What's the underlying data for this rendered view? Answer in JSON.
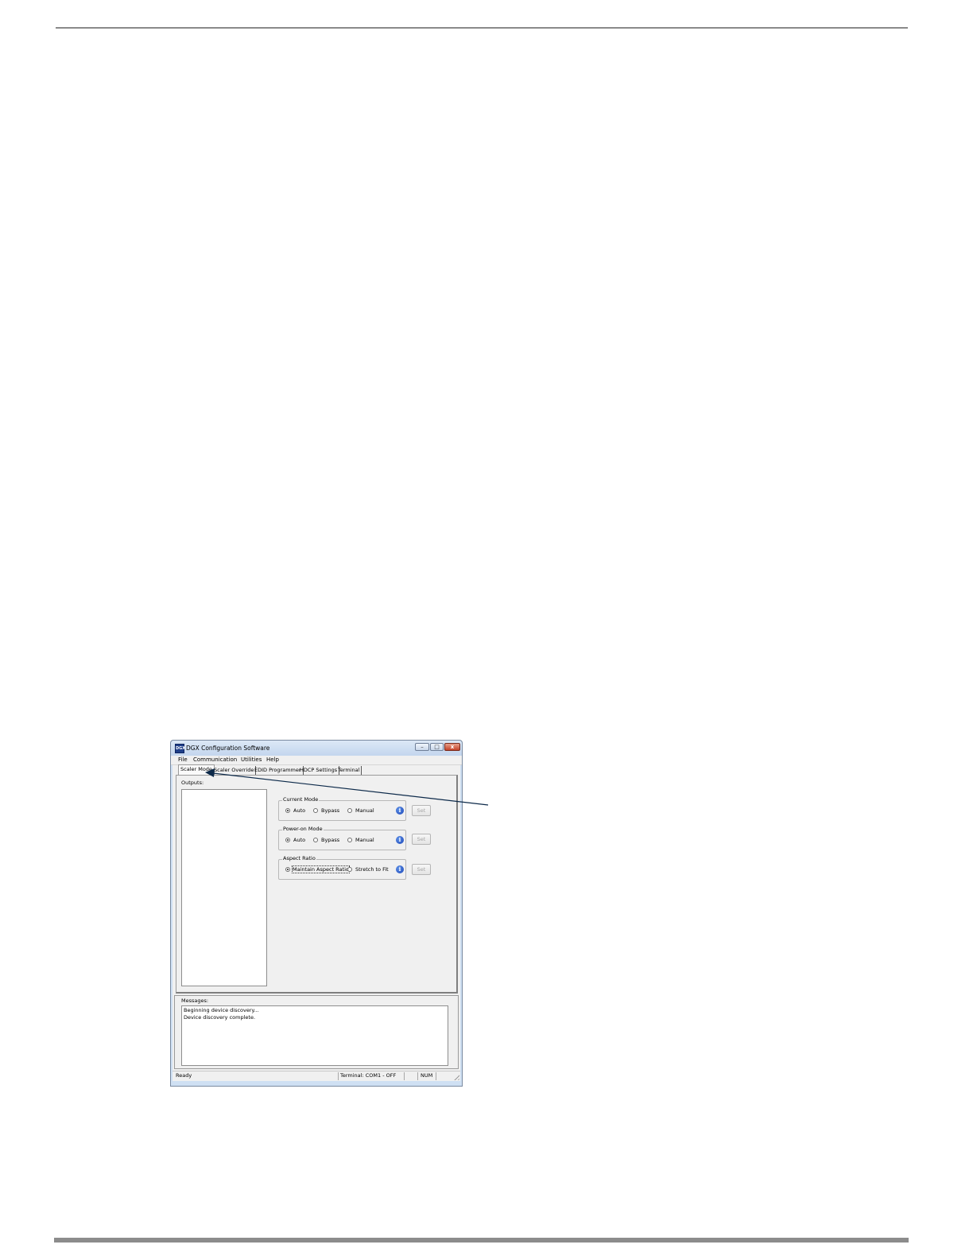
{
  "window": {
    "app_icon_text": "DGX",
    "title": "DGX Configuration Software",
    "minimize_glyph": "–",
    "maximize_glyph": "□",
    "close_glyph": "x"
  },
  "menu": {
    "items": [
      "File",
      "Communication",
      "Utilities",
      "Help"
    ]
  },
  "tabs": {
    "items": [
      "Scaler Mode",
      "Scaler Override",
      "EDID Programmer",
      "HDCP Settings",
      "Terminal"
    ],
    "active": "Scaler Mode"
  },
  "scaler_mode": {
    "outputs_label": "Outputs:",
    "current_mode": {
      "title": "Current Mode",
      "options": [
        "Auto",
        "Bypass",
        "Manual"
      ],
      "selected": "Auto",
      "set_label": "Set"
    },
    "power_on_mode": {
      "title": "Power-on Mode",
      "options": [
        "Auto",
        "Bypass",
        "Manual"
      ],
      "selected": "Auto",
      "set_label": "Set"
    },
    "aspect_ratio": {
      "title": "Aspect Ratio",
      "options": [
        "Maintain Aspect Ratio",
        "Stretch to Fit"
      ],
      "selected": "Maintain Aspect Ratio",
      "set_label": "Set"
    },
    "info_glyph": "i"
  },
  "messages": {
    "label": "Messages:",
    "lines": [
      "Beginning device discovery...",
      "Device discovery complete."
    ]
  },
  "statusbar": {
    "status": "Ready",
    "terminal": "Terminal: COM1 - OFF",
    "num": "NUM"
  },
  "colors": {
    "rule": "#8a8a8a",
    "window_frame": "#cfe0f3",
    "close_button": "#c4432a",
    "info_icon": "#1c46b8",
    "callout_arrow": "#0d2a4a"
  }
}
